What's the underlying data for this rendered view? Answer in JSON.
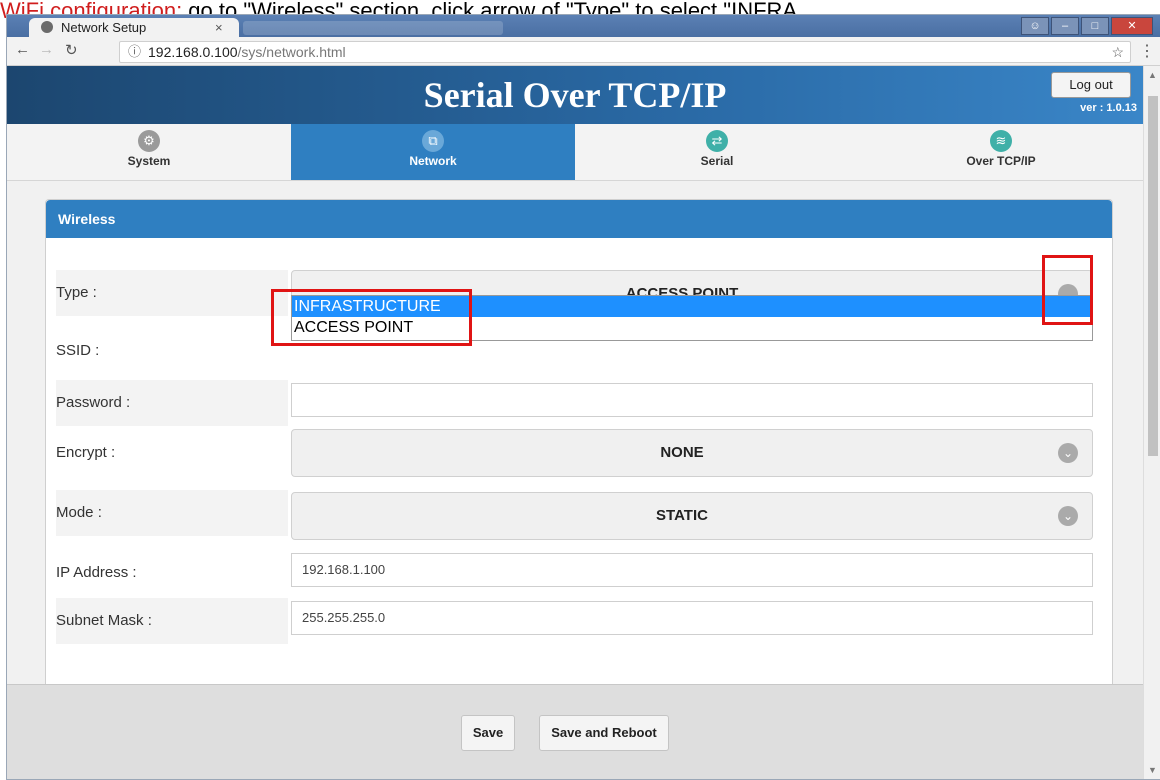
{
  "caption": {
    "prefix": "WiFi configuration:",
    "rest": " go to \"Wireless\" section, click arrow of \"Type\" to select \"INFRA"
  },
  "browser": {
    "tab_title": "Network Setup",
    "tab_close": "×",
    "url_host": "192.168.0.100",
    "url_path": "/sys/network.html"
  },
  "header": {
    "title": "Serial Over TCP/IP",
    "logout_label": "Log out",
    "version": "ver : 1.0.13"
  },
  "nav": {
    "items": [
      {
        "label": "System",
        "icon": "gear-icon"
      },
      {
        "label": "Network",
        "icon": "network-icon"
      },
      {
        "label": "Serial",
        "icon": "arrows-icon"
      },
      {
        "label": "Over TCP/IP",
        "icon": "wifi-icon"
      }
    ],
    "active": "Network"
  },
  "wireless": {
    "section_title": "Wireless",
    "type": {
      "label": "Type :",
      "value": "ACCESS POINT"
    },
    "type_options": [
      "INFRASTRUCTURE",
      "ACCESS POINT"
    ],
    "type_highlighted_option": "INFRASTRUCTURE",
    "ssid": {
      "label": "SSID :",
      "value": ""
    },
    "password": {
      "label": "Password :",
      "value": ""
    },
    "encrypt": {
      "label": "Encrypt :",
      "value": "NONE"
    },
    "mode": {
      "label": "Mode :",
      "value": "STATIC"
    },
    "ip_address": {
      "label": "IP Address :",
      "value": "192.168.1.100"
    },
    "subnet_mask": {
      "label": "Subnet Mask :",
      "value": "255.255.255.0"
    }
  },
  "footer": {
    "save_label": "Save",
    "save_reboot_label": "Save and Reboot"
  },
  "colors": {
    "accent": "#2f7fc1",
    "highlight_box": "#e01414",
    "option_highlight": "#1e90ff"
  }
}
